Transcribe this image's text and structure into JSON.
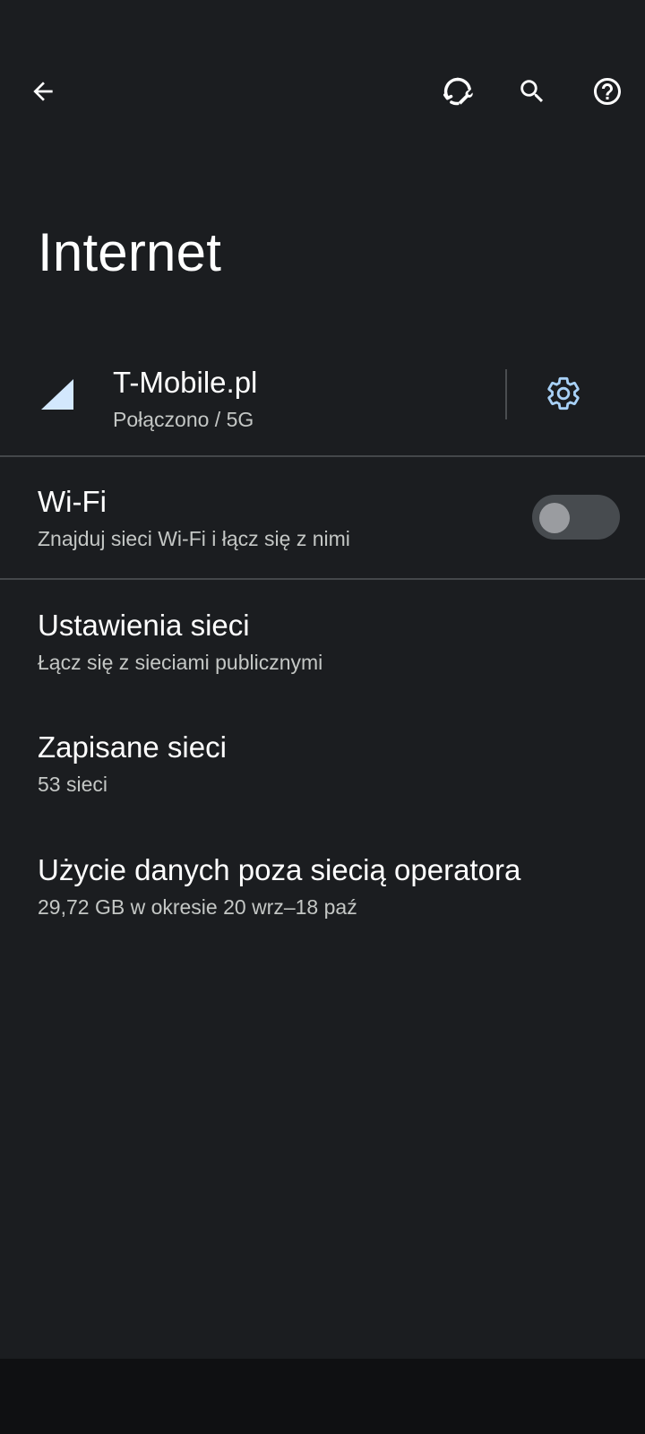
{
  "toolbar": {
    "back_icon": "arrow-back-icon",
    "troubleshoot_icon": "network-troubleshoot-icon",
    "search_icon": "search-icon",
    "help_icon": "help-circle-icon"
  },
  "page": {
    "title": "Internet"
  },
  "carrier": {
    "name": "T-Mobile.pl",
    "status": "Połączono / 5G",
    "signal_icon": "cell-signal-icon",
    "settings_icon": "gear-icon",
    "signal_color": "#d3e8fd",
    "gear_color": "#a8d1f7"
  },
  "wifi": {
    "title": "Wi-Fi",
    "summary": "Znajduj sieci Wi-Fi i łącz się z nimi",
    "enabled": false
  },
  "items": [
    {
      "title": "Ustawienia sieci",
      "summary": "Łącz się z sieciami publicznymi"
    },
    {
      "title": "Zapisane sieci",
      "summary": "53 sieci"
    },
    {
      "title": "Użycie danych poza siecią operatora",
      "summary": "29,72 GB w okresie 20 wrz–18 paź"
    }
  ]
}
